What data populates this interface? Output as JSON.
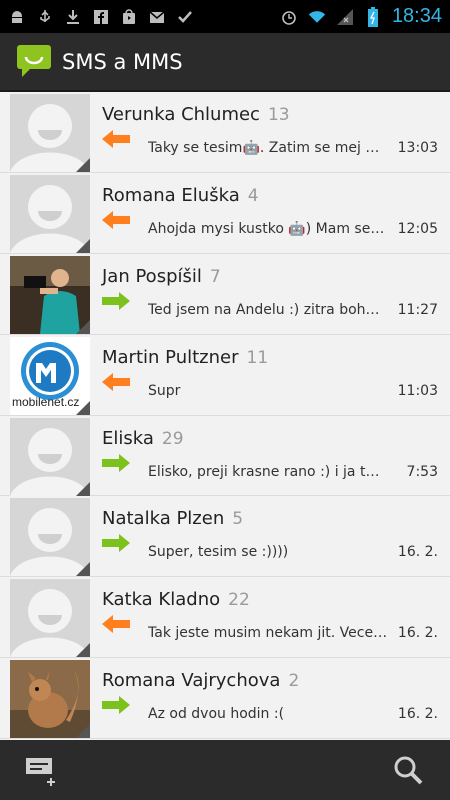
{
  "status_bar": {
    "time": "18:34",
    "left_icons": [
      "android-debug-icon",
      "usb-icon",
      "download-icon",
      "facebook-icon",
      "play-store-icon",
      "gmail-icon",
      "checkmark-icon"
    ],
    "right_icons": [
      "alarm-icon",
      "wifi-icon",
      "signal-icon",
      "battery-icon"
    ]
  },
  "action_bar": {
    "title": "SMS a MMS"
  },
  "threads": [
    {
      "name": "Verunka Chlumec",
      "count": "13",
      "direction": "in",
      "snippet": "Taky se tesim🤖. Zatim se mej m...",
      "time": "13:03"
    },
    {
      "name": "Romana Eluška",
      "count": "4",
      "direction": "in",
      "snippet": "Ahojda mysi kustko 🤖) Mam se f...",
      "time": "12:05"
    },
    {
      "name": "Jan Pospíšil",
      "count": "7",
      "direction": "out",
      "snippet": "Ted jsem na Andelu :) zitra bohuzel...",
      "time": "11:27"
    },
    {
      "name": "Martin Pultzner",
      "count": "11",
      "direction": "in",
      "snippet": "Supr",
      "time": "11:03"
    },
    {
      "name": "Eliska",
      "count": "29",
      "direction": "out",
      "snippet": "Elisko, preji krasne rano :) i ja te rad ...",
      "time": "7:53"
    },
    {
      "name": "Natalka Plzen",
      "count": "5",
      "direction": "out",
      "snippet": "Super, tesim se :))))",
      "time": "16. 2."
    },
    {
      "name": "Katka Kladno",
      "count": "22",
      "direction": "in",
      "snippet": "Tak jeste musim nekam jit. Vecer al...",
      "time": "16. 2."
    },
    {
      "name": "Romana Vajrychova",
      "count": "2",
      "direction": "out",
      "snippet": "Az od dvou hodin :(",
      "time": "16. 2."
    }
  ],
  "avatar_text": {
    "mobilenet": "mobilenet.cz"
  },
  "colors": {
    "incoming_arrow": "#ff7f1f",
    "outgoing_arrow": "#7cc11c",
    "accent_time": "#33b5e5"
  }
}
